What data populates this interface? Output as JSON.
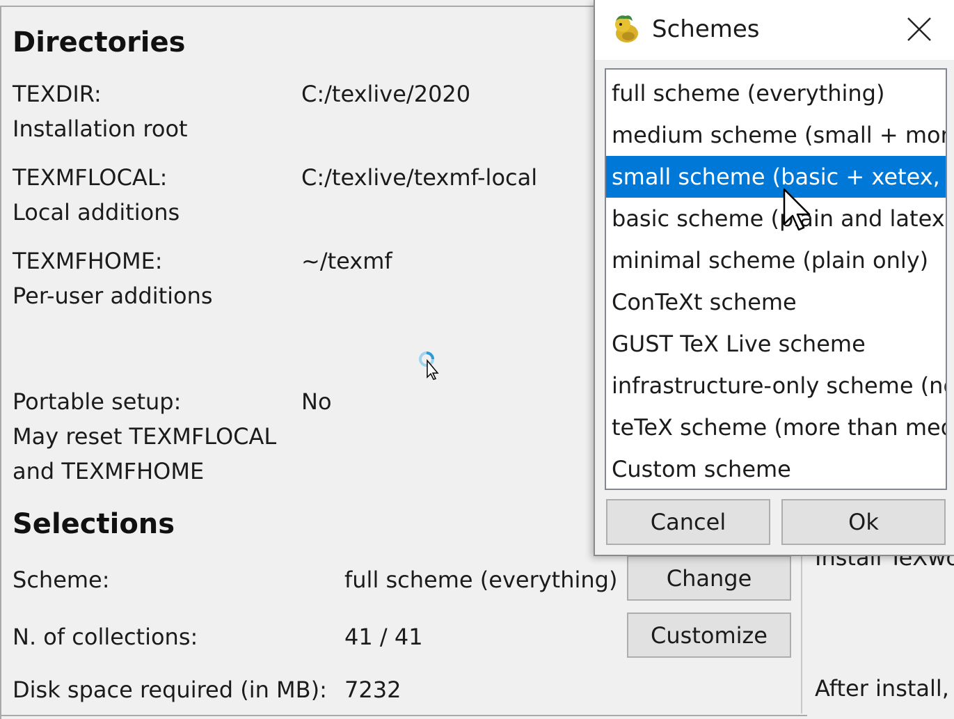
{
  "directories": {
    "heading": "Directories",
    "rows": [
      {
        "label": "TEXDIR:",
        "value": "C:/texlive/2020",
        "note": "Installation root"
      },
      {
        "label": "TEXMFLOCAL:",
        "value": "C:/texlive/texmf-local",
        "note": "Local additions"
      },
      {
        "label": "TEXMFHOME:",
        "value": "~/texmf",
        "note": "Per-user additions"
      }
    ],
    "portable": {
      "label": "Portable setup:",
      "value": "No",
      "note_line1": "May reset TEXMFLOCAL",
      "note_line2": "and TEXMFHOME"
    }
  },
  "selections": {
    "heading": "Selections",
    "scheme_label": "Scheme:",
    "scheme_value": "full scheme (everything)",
    "change_button": "Change",
    "collections_label": "N. of collections:",
    "collections_value": "41 / 41",
    "customize_button": "Customize",
    "disk_label": "Disk space required (in MB):",
    "disk_value": "7232"
  },
  "right_panel": {
    "install_texworks_partial": "Install TeXwo",
    "after_install_partial": "After install,"
  },
  "schemes_dialog": {
    "title": "Schemes",
    "items": [
      "full scheme (everything)",
      "medium scheme (small + more packages and languages)",
      "small scheme (basic + xetex, metapost, a few languages)",
      "basic scheme (plain and latex)",
      "minimal scheme (plain only)",
      "ConTeXt scheme",
      "GUST TeX Live scheme",
      "infrastructure-only scheme (no TeX at all)",
      "teTeX scheme (more than medium, but nowhere near full)",
      "Custom scheme"
    ],
    "selected_index": 2,
    "cancel_button": "Cancel",
    "ok_button": "Ok"
  },
  "icons": {
    "app_icon": "texlive-lion-icon",
    "close_icon": "close-icon",
    "mouse_cursor": "arrow-cursor-icon",
    "busy_cursor": "busy-cursor-icon"
  },
  "colors": {
    "selection": "#0078d7",
    "background": "#f0f0f0",
    "button": "#e1e1e1"
  }
}
